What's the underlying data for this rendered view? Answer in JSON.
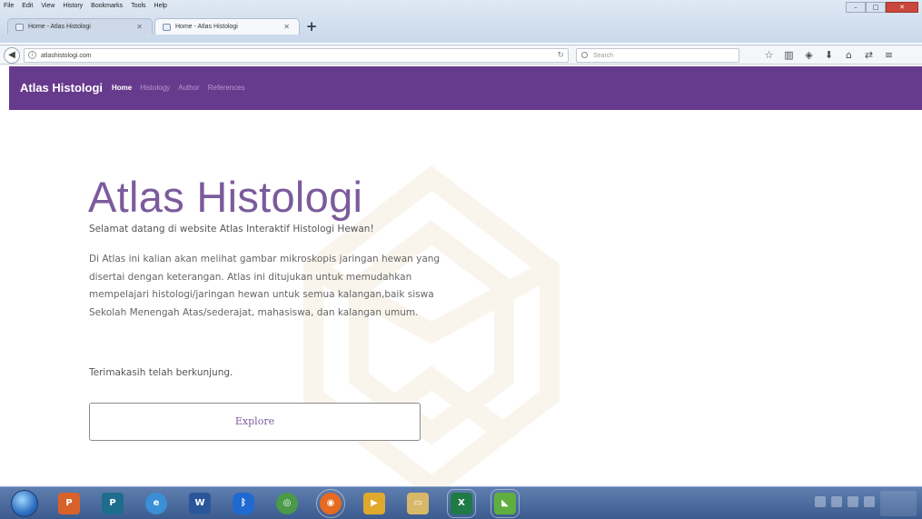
{
  "browser": {
    "menu": [
      "File",
      "Edit",
      "View",
      "History",
      "Bookmarks",
      "Tools",
      "Help"
    ],
    "tabs": [
      {
        "title": "Home - Atlas Histologi",
        "active": false
      },
      {
        "title": "Home - Atlas Histologi",
        "active": true
      }
    ],
    "url": "atlashistologi.com",
    "search_placeholder": "Search",
    "toolbar_icons": [
      "star-icon",
      "library-icon",
      "pocket-icon",
      "download-icon",
      "home-icon",
      "sync-icon",
      "menu-icon"
    ]
  },
  "site": {
    "brand": "Atlas Histologi",
    "nav": [
      "Home",
      "Histology",
      "Author",
      "References"
    ],
    "active_nav": "Home",
    "colors": {
      "nav_bg": "#663a8c",
      "accent": "#7b5b9c"
    }
  },
  "hero": {
    "title": "Atlas Histologi",
    "welcome": "Selamat datang di website Atlas Interaktif Histologi Hewan!",
    "description": "Di Atlas ini kalian akan melihat gambar mikroskopis jaringan hewan yang disertai dengan keterangan. Atlas ini ditujukan untuk memudahkan mempelajari histologi/jaringan hewan untuk semua kalangan,baik siswa Sekolah Menengah Atas/sederajat, mahasiswa, dan kalangan umum.",
    "thanks": "Terimakasih telah berkunjung.",
    "button": "Explore"
  },
  "taskbar": {
    "apps": [
      "internet-explorer-icon",
      "powerpoint-icon",
      "publisher-icon",
      "ie-icon",
      "word-icon",
      "bluetooth-icon",
      "chrome-icon",
      "firefox-icon",
      "media-player-icon",
      "explorer-icon",
      "excel-icon",
      "app-icon"
    ]
  }
}
